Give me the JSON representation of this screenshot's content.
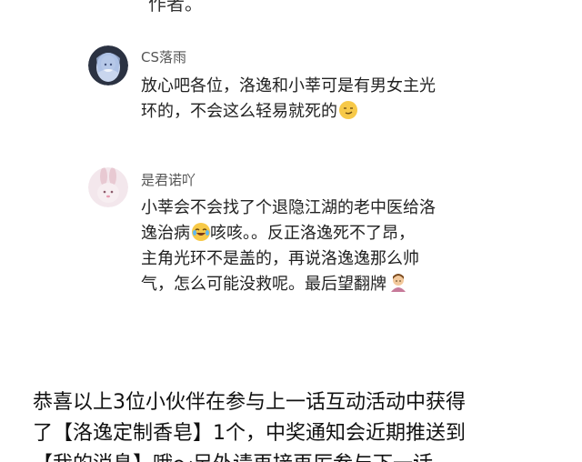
{
  "top_fragment": "作者。",
  "comments": [
    {
      "username": "CS落雨",
      "lines": [
        "放心吧各位，洛逸和小莘可是有男女主光",
        "环的，不会这么轻易就死的"
      ],
      "trailing_emoji": "smirk-emoji"
    },
    {
      "username": "是君诺吖",
      "line1": "小莘会不会找了个退隐江湖的老中医给洛",
      "line2_a": "逸治病",
      "line2_emoji": "tears-of-joy-emoji",
      "line2_b": "咳咳。。反正洛逸死不了昂，",
      "line3": "主角光环不是盖的，再说洛逸逸那么帅",
      "line4": "气，怎么可能没救呢。最后望翻牌",
      "line4_emoji": "person-bowing-emoji"
    }
  ],
  "announcement": {
    "line1": "恭喜以上3位小伙伴在参与上一话互动活动中获得",
    "line2": "了【洛逸定制香皂】1个，中奖通知会近期推送到",
    "line3_partial": "【我的消息】哦～另外请再接再厉参与下一话"
  },
  "colors": {
    "background": "#ffffff",
    "text": "#222222",
    "username": "#555555"
  }
}
